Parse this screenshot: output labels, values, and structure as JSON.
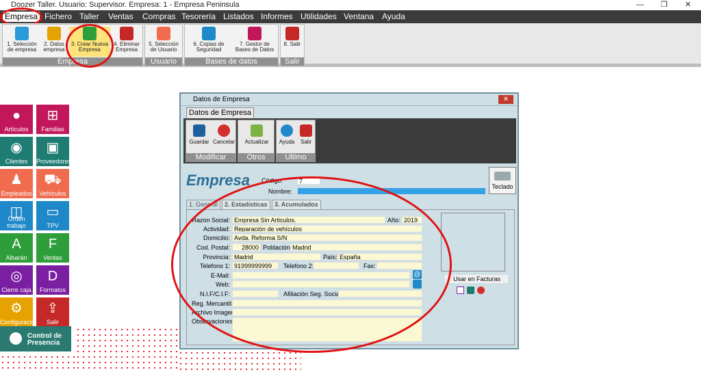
{
  "window": {
    "title": "Doozer Taller. Usuario: Supervisor. Empresa: 1 - Empresa Peninsula",
    "minimize": "—",
    "restore": "❐",
    "close": "✕"
  },
  "menu": [
    "Empresa",
    "Fichero",
    "Taller",
    "Ventas",
    "Compras",
    "Tesorería",
    "Listados",
    "Informes",
    "Utilidades",
    "Ventana",
    "Ayuda"
  ],
  "ribbon": {
    "groups": [
      "Empresa",
      "Usuario",
      "Bases de datos",
      "Salir"
    ],
    "buttons": [
      {
        "label": "1. Selección de empresa"
      },
      {
        "label": "2. Datos empresa"
      },
      {
        "label": "3. Crear Nueva Empresa"
      },
      {
        "label": "4. Eliminar Empresa"
      },
      {
        "label": "5. Selección de Usuario"
      },
      {
        "label": "6. Copias de Seguridad"
      },
      {
        "label": "7. Gestor de Bases de Datos"
      },
      {
        "label": "8. Salir"
      }
    ]
  },
  "sidebar": [
    {
      "label": "Artículos",
      "color": "#c2185b"
    },
    {
      "label": "Familias",
      "color": "#c2185b"
    },
    {
      "label": "Clientes",
      "color": "#1f7c73"
    },
    {
      "label": "Proveedores",
      "color": "#1f7c73"
    },
    {
      "label": "Empleados",
      "color": "#ef6c4f"
    },
    {
      "label": "Vehículos",
      "color": "#ef6c4f"
    },
    {
      "label": "Orden trabajo",
      "color": "#1e88c8"
    },
    {
      "label": "TPV",
      "color": "#1e88c8"
    },
    {
      "label": "Albarán",
      "color": "#2e9e3a"
    },
    {
      "label": "Ventas",
      "color": "#2e9e3a"
    },
    {
      "label": "Cierre caja",
      "color": "#7b1fa2"
    },
    {
      "label": "Formatos",
      "color": "#7b1fa2"
    },
    {
      "label": "Configuración",
      "color": "#e6a200"
    },
    {
      "label": "Salir",
      "color": "#c62828"
    }
  ],
  "control": {
    "label": "Control de Presencia"
  },
  "dialog": {
    "title": "Datos de Empresa",
    "tab": "Datos de Empresa",
    "groups": [
      "Modificar",
      "Otros",
      "Ultimo"
    ],
    "buttons": [
      "Guardar",
      "Cancelar",
      "Actualizar",
      "Ayuda",
      "Salir"
    ],
    "brand": "Empresa",
    "codigo_label": "Código:",
    "codigo": "7",
    "nombre_label": "Nombre:",
    "teclado": "Teclado",
    "tabs": [
      "1. General",
      "2. Estadísticas",
      "3. Acumulados"
    ],
    "fields": {
      "razon_label": "Razon Social:",
      "razon": "Empresa Sin Articulos.",
      "anio_label": "Año:",
      "anio": "2019",
      "actividad_label": "Actividad:",
      "actividad": "Reparación de vehículos",
      "domicilio_label": "Domicilio:",
      "domicilio": "Avda. Reforma S/N",
      "cp_label": "Cod. Postal:",
      "cp": "28000",
      "poblacion_label": "Población:",
      "poblacion": "Madrid",
      "provincia_label": "Provincia:",
      "provincia": "Madrid",
      "pais_label": "País:",
      "pais": "España",
      "tel1_label": "Telefono 1:",
      "tel1": "91999999999",
      "tel2_label": "Telefono 2:",
      "fax_label": "Fax:",
      "email_label": "E-Mail:",
      "web_label": "Web:",
      "nif_label": "N.I.F/C.I.F:",
      "afiliacion_label": "Afiliación Seg. Social:",
      "mercantil_label": "Reg. Mercantil:",
      "archivo_label": "Archivo Imagen:",
      "obs_label": "Observaciones:"
    },
    "usar_facturas": "Usar en Facturas"
  }
}
